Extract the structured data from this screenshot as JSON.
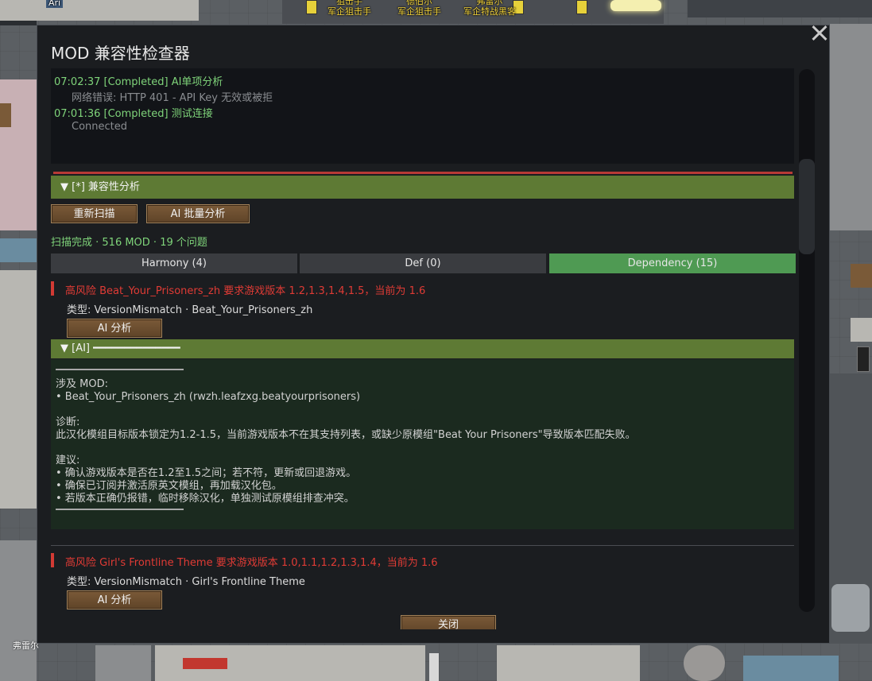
{
  "background": {
    "colonist_labels": [
      {
        "name": "狙击手",
        "role": "军企狙击手"
      },
      {
        "name": "德伯尔",
        "role": "军企狙击手"
      },
      {
        "name": "弗雷尔",
        "role": "军企特战黑客"
      }
    ],
    "tag_top_left": "Ari",
    "bottom_name": "弗雷尔"
  },
  "dialog": {
    "title": "MOD 兼容性检查器",
    "log": [
      {
        "text": "07:02:37 [Completed] AI单项分析",
        "kind": "ok"
      },
      {
        "text": "网络错误: HTTP 401 - API Key 无效或被拒",
        "kind": "sub"
      },
      {
        "text": "07:01:36 [Completed] 测试连接",
        "kind": "ok"
      },
      {
        "text": "Connected",
        "kind": "sub"
      }
    ],
    "section_header": "▼ [*] 兼容性分析",
    "buttons": {
      "rescan": "重新扫描",
      "ai_batch": "AI 批量分析",
      "ai_single": "AI 分析",
      "close": "关闭"
    },
    "status": "扫描完成 · 516 MOD · 19 个问题",
    "tabs": [
      {
        "label": "Harmony (4)",
        "active": false
      },
      {
        "label": "Def (0)",
        "active": false
      },
      {
        "label": "Dependency (15)",
        "active": true
      }
    ],
    "issues": [
      {
        "title": "高风险  Beat_Your_Prisoners_zh 要求游戏版本 1.2,1.3,1.4,1.5，当前为 1.6",
        "type": "类型: VersionMismatch · Beat_Your_Prisoners_zh"
      },
      {
        "title": "高风险  Girl's Frontline Theme 要求游戏版本 1.0,1.1,1.2,1.3,1.4，当前为 1.6",
        "type": "类型: VersionMismatch · Girl's Frontline Theme"
      }
    ],
    "ai_header": "▼ [AI] ━━━━━━━━━━━━━━",
    "ai_result": {
      "mods_label": "涉及 MOD:",
      "mods_item": "  • Beat_Your_Prisoners_zh (rwzh.leafzxg.beatyourprisoners)",
      "diag_label": "诊断:",
      "diag_text": "  此汉化模组目标版本锁定为1.2-1.5，当前游戏版本不在其支持列表，或缺少原模组\"Beat Your Prisoners\"导致版本匹配失败。",
      "sugg_label": "建议:",
      "sugg_items": [
        "  • 确认游戏版本是否在1.2至1.5之间；若不符，更新或回退游戏。",
        "  • 确保已订阅并激活原英文模组，再加载汉化包。",
        "  • 若版本正确仍报错，临时移除汉化，单独测试原模组排查冲突。"
      ]
    },
    "colors": {
      "accent_green": "#5e7a34",
      "tab_active": "#4f9a53",
      "danger": "#e03b35",
      "ok_text": "#7fd47a"
    }
  }
}
